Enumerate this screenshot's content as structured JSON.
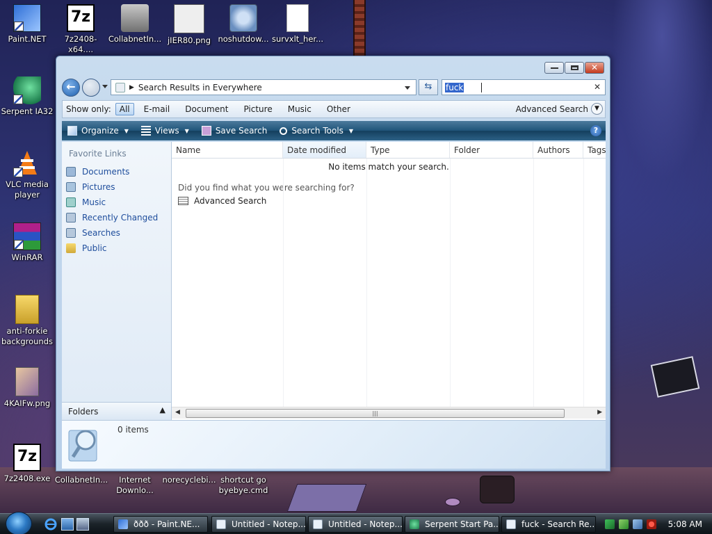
{
  "desktop": {
    "icons": [
      {
        "label": "Paint.NET"
      },
      {
        "label": "7z2408-x64...."
      },
      {
        "label": "CollabnetIn..."
      },
      {
        "label": "jIER80.png"
      },
      {
        "label": "noshutdow..."
      },
      {
        "label": "survxlt_her..."
      },
      {
        "label": "Serpent IA32"
      },
      {
        "label": "VLC media player"
      },
      {
        "label": "WinRAR"
      },
      {
        "label": "anti-forkie backgrounds"
      },
      {
        "label": "4KAIFw.png"
      },
      {
        "label": "7z2408.exe"
      },
      {
        "label": "CollabnetIn..."
      },
      {
        "label": "Internet Downlo..."
      },
      {
        "label": "norecyclebi..."
      },
      {
        "label": "shortcut go byebye.cmd"
      }
    ]
  },
  "window": {
    "address": {
      "path": "Search Results in Everywhere"
    },
    "search": {
      "value": "fuck"
    },
    "filter": {
      "label": "Show only:",
      "options": [
        "All",
        "E-mail",
        "Document",
        "Picture",
        "Music",
        "Other"
      ],
      "active": "All",
      "advanced": "Advanced Search"
    },
    "commands": {
      "organize": "Organize",
      "views": "Views",
      "save_search": "Save Search",
      "search_tools": "Search Tools"
    },
    "nav": {
      "header": "Favorite Links",
      "items": [
        {
          "label": "Documents",
          "icon": "documents-icon"
        },
        {
          "label": "Pictures",
          "icon": "pictures-icon"
        },
        {
          "label": "Music",
          "icon": "music-icon"
        },
        {
          "label": "Recently Changed",
          "icon": "recently-changed-icon"
        },
        {
          "label": "Searches",
          "icon": "searches-icon"
        },
        {
          "label": "Public",
          "icon": "public-folder-icon"
        }
      ],
      "folders": "Folders"
    },
    "columns": [
      "Name",
      "Date modified",
      "Type",
      "Folder",
      "Authors",
      "Tags"
    ],
    "empty_message": "No items match your search.",
    "prompt": "Did you find what you were searching for?",
    "advanced_link": "Advanced Search",
    "details": {
      "count": "0 items"
    }
  },
  "taskbar": {
    "buttons": [
      {
        "label": "ððð - Paint.NE..."
      },
      {
        "label": "Untitled - Notep..."
      },
      {
        "label": "Untitled - Notep..."
      },
      {
        "label": "Serpent Start Pa..."
      },
      {
        "label": "fuck - Search Re...",
        "active": true
      }
    ],
    "clock": "5:08 AM"
  }
}
